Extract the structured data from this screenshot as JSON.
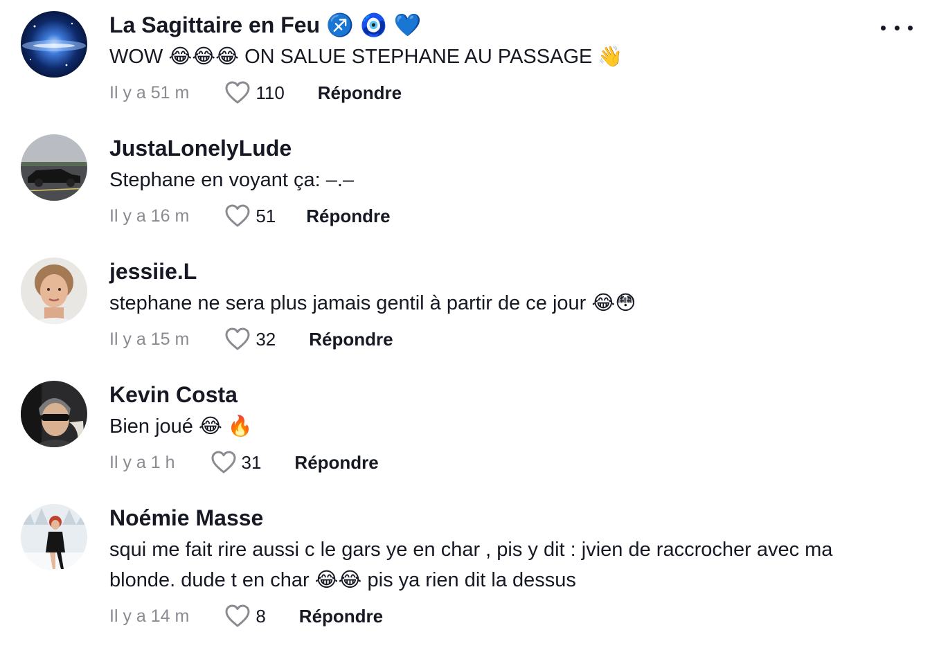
{
  "comments": [
    {
      "username": "La Sagittaire en Feu ♐️ 🧿 💙",
      "text": "WOW 😂😂😂 ON SALUE STEPHANE AU PASSAGE 👋",
      "time": "Il y a 51 m",
      "likes": "110",
      "reply_label": "Répondre",
      "avatar_icon": "galaxy-avatar"
    },
    {
      "username": "JustaLonelyLude",
      "text": "Stephane en voyant ça: –.–",
      "time": "Il y a 16 m",
      "likes": "51",
      "reply_label": "Répondre",
      "avatar_icon": "car-avatar"
    },
    {
      "username": "jessiie.L",
      "text": "stephane ne sera plus jamais gentil à partir de ce jour 😂😳",
      "time": "Il y a 15 m",
      "likes": "32",
      "reply_label": "Répondre",
      "avatar_icon": "woman-portrait-avatar"
    },
    {
      "username": "Kevin Costa",
      "text": "Bien joué 😂 🔥",
      "time": "Il y a 1 h",
      "likes": "31",
      "reply_label": "Répondre",
      "avatar_icon": "man-sunglasses-avatar"
    },
    {
      "username": "Noémie Masse",
      "text": "squi me fait rire aussi c le gars ye en char , pis y dit : jvien de raccrocher avec ma blonde. dude t en char 😂😂 pis ya rien dit la dessus",
      "time": "Il y a 14 m",
      "likes": "8",
      "reply_label": "Répondre",
      "avatar_icon": "woman-snow-avatar"
    }
  ],
  "colors": {
    "text": "#161823",
    "secondary": "#8a8b91",
    "background": "#ffffff"
  },
  "icons": {
    "more": "more-horizontal-icon",
    "like": "heart-outline-icon"
  }
}
